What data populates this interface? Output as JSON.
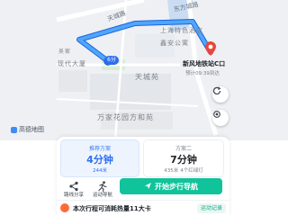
{
  "map": {
    "road_north": "天城路",
    "road_east": "东方城路",
    "poi_hotel": "上海特色酒店",
    "poi_ne": "鑫安公寓",
    "district_mid": "天城苑",
    "district_west": "现代大厦",
    "district_south": "万家花园方和苑",
    "small_label": "吴家",
    "route_eta_chip": "6分",
    "destination_name": "新风地铁站C口",
    "destination_eta": "预计09:39到达",
    "map_provider": "高德地图",
    "colors": {
      "route": "#4ea6ff",
      "route_casing": "#1d63d6",
      "destination_pin": "#e8463c"
    }
  },
  "plans": {
    "recommended": {
      "tag": "推荐方案",
      "duration": "4分钟",
      "distance": "244米"
    },
    "alt": {
      "tag": "方案二",
      "duration": "7分钟",
      "distance": "435米",
      "extra": "4个红绿灯"
    }
  },
  "actions": {
    "share_label": "路线分享",
    "sport_label": "运动导航",
    "start_label": "开始步行导航"
  },
  "banner": {
    "text": "本次行程可消耗热量11大卡",
    "link": "运动记录"
  },
  "colors": {
    "primary_blue": "#2d6ef0",
    "start_green": "#10c39a"
  }
}
